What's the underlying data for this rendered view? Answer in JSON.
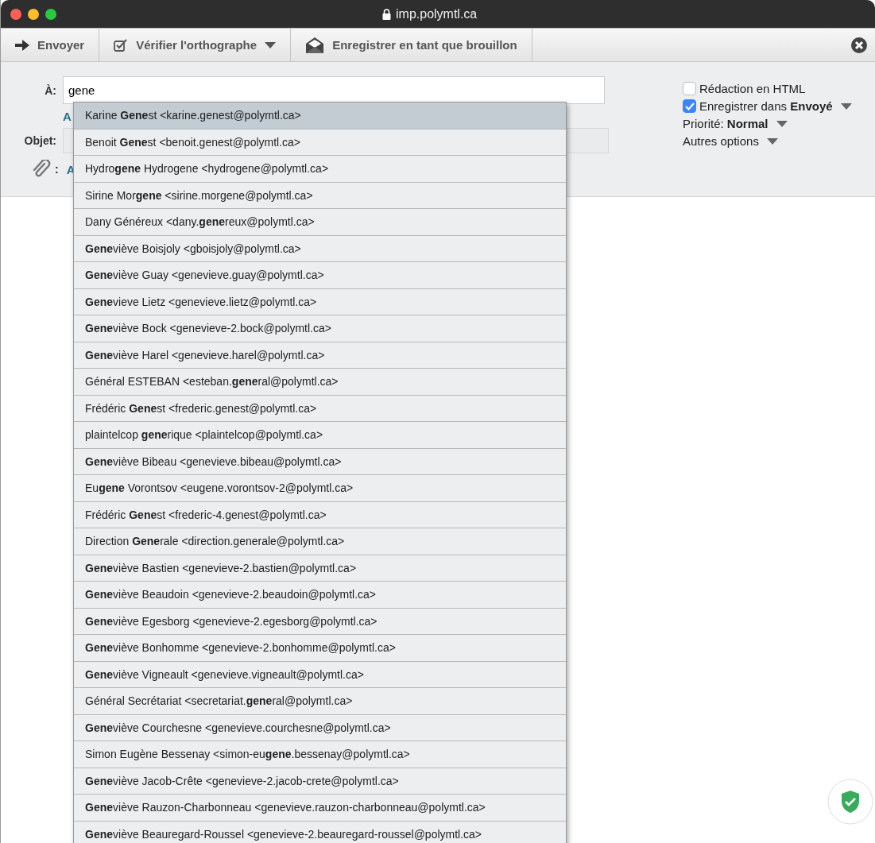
{
  "window": {
    "title": "imp.polymtl.ca"
  },
  "toolbar": {
    "buttons": [
      {
        "label": "Envoyer",
        "menu": false
      },
      {
        "label": "Vérifier l'orthographe",
        "menu": true
      },
      {
        "label": "Enregistrer en tant que brouillon",
        "menu": false
      }
    ]
  },
  "form": {
    "to_label": "À:",
    "to_value": "gene",
    "to_hidden_fragment": "A",
    "subject_label": "Objet:",
    "attach_label": ":",
    "attach_fragment": "A"
  },
  "options": [
    {
      "kind": "checkbox",
      "label": "Rédaction en HTML",
      "checked": false,
      "menu": false
    },
    {
      "kind": "checkbox",
      "label": "Enregistrer dans **Envoyé**",
      "checked": true,
      "menu": true
    },
    {
      "kind": "text",
      "label": "Priorité: **Normal**",
      "menu": true
    },
    {
      "kind": "text",
      "label": "Autres options",
      "menu": true
    }
  ],
  "suggestions": [
    {
      "text": "Karine **Gene**st <karine.genest@polymtl.ca>",
      "selected": true
    },
    {
      "text": "Benoit **Gene**st <benoit.genest@polymtl.ca>",
      "selected": false
    },
    {
      "text": "Hydro**gene** Hydrogene <hydrogene@polymtl.ca>",
      "selected": false
    },
    {
      "text": "Sirine Mor**gene** <sirine.morgene@polymtl.ca>",
      "selected": false
    },
    {
      "text": "Dany Généreux <dany.**gene**reux@polymtl.ca>",
      "selected": false
    },
    {
      "text": "**Gene**viève Boisjoly <gboisjoly@polymtl.ca>",
      "selected": false
    },
    {
      "text": "**Gene**viève Guay <genevieve.guay@polymtl.ca>",
      "selected": false
    },
    {
      "text": "**Gene**vieve Lietz <genevieve.lietz@polymtl.ca>",
      "selected": false
    },
    {
      "text": "**Gene**viève Bock <genevieve-2.bock@polymtl.ca>",
      "selected": false
    },
    {
      "text": "**Gene**viève Harel <genevieve.harel@polymtl.ca>",
      "selected": false
    },
    {
      "text": "Général ESTEBAN <esteban.**gene**ral@polymtl.ca>",
      "selected": false
    },
    {
      "text": "Frédéric **Gene**st <frederic.genest@polymtl.ca>",
      "selected": false
    },
    {
      "text": "plaintelcop **gene**rique <plaintelcop@polymtl.ca>",
      "selected": false
    },
    {
      "text": "**Gene**viève Bibeau <genevieve.bibeau@polymtl.ca>",
      "selected": false
    },
    {
      "text": "Eu**gene** Vorontsov <eugene.vorontsov-2@polymtl.ca>",
      "selected": false
    },
    {
      "text": "Frédéric **Gene**st <frederic-4.genest@polymtl.ca>",
      "selected": false
    },
    {
      "text": "Direction **Gene**rale <direction.generale@polymtl.ca>",
      "selected": false
    },
    {
      "text": "**Gene**viève Bastien <genevieve-2.bastien@polymtl.ca>",
      "selected": false
    },
    {
      "text": "**Gene**viève Beaudoin <genevieve-2.beaudoin@polymtl.ca>",
      "selected": false
    },
    {
      "text": "**Gene**viève Egesborg <genevieve-2.egesborg@polymtl.ca>",
      "selected": false
    },
    {
      "text": "**Gene**viève Bonhomme <genevieve-2.bonhomme@polymtl.ca>",
      "selected": false
    },
    {
      "text": "**Gene**viève Vigneault <genevieve.vigneault@polymtl.ca>",
      "selected": false
    },
    {
      "text": "Général Secrétariat <secretariat.**gene**ral@polymtl.ca>",
      "selected": false
    },
    {
      "text": "**Gene**viève Courchesne <genevieve.courchesne@polymtl.ca>",
      "selected": false
    },
    {
      "text": "Simon Eugène Bessenay <simon-eu**gene**.bessenay@polymtl.ca>",
      "selected": false
    },
    {
      "text": "**Gene**viève Jacob-Crête <genevieve-2.jacob-crete@polymtl.ca>",
      "selected": false
    },
    {
      "text": "**Gene**viève Rauzon-Charbonneau <genevieve.rauzon-charbonneau@polymtl.ca>",
      "selected": false
    },
    {
      "text": "**Gene**viève Beauregard-Roussel <genevieve-2.beauregard-roussel@polymtl.ca>",
      "selected": false
    }
  ]
}
